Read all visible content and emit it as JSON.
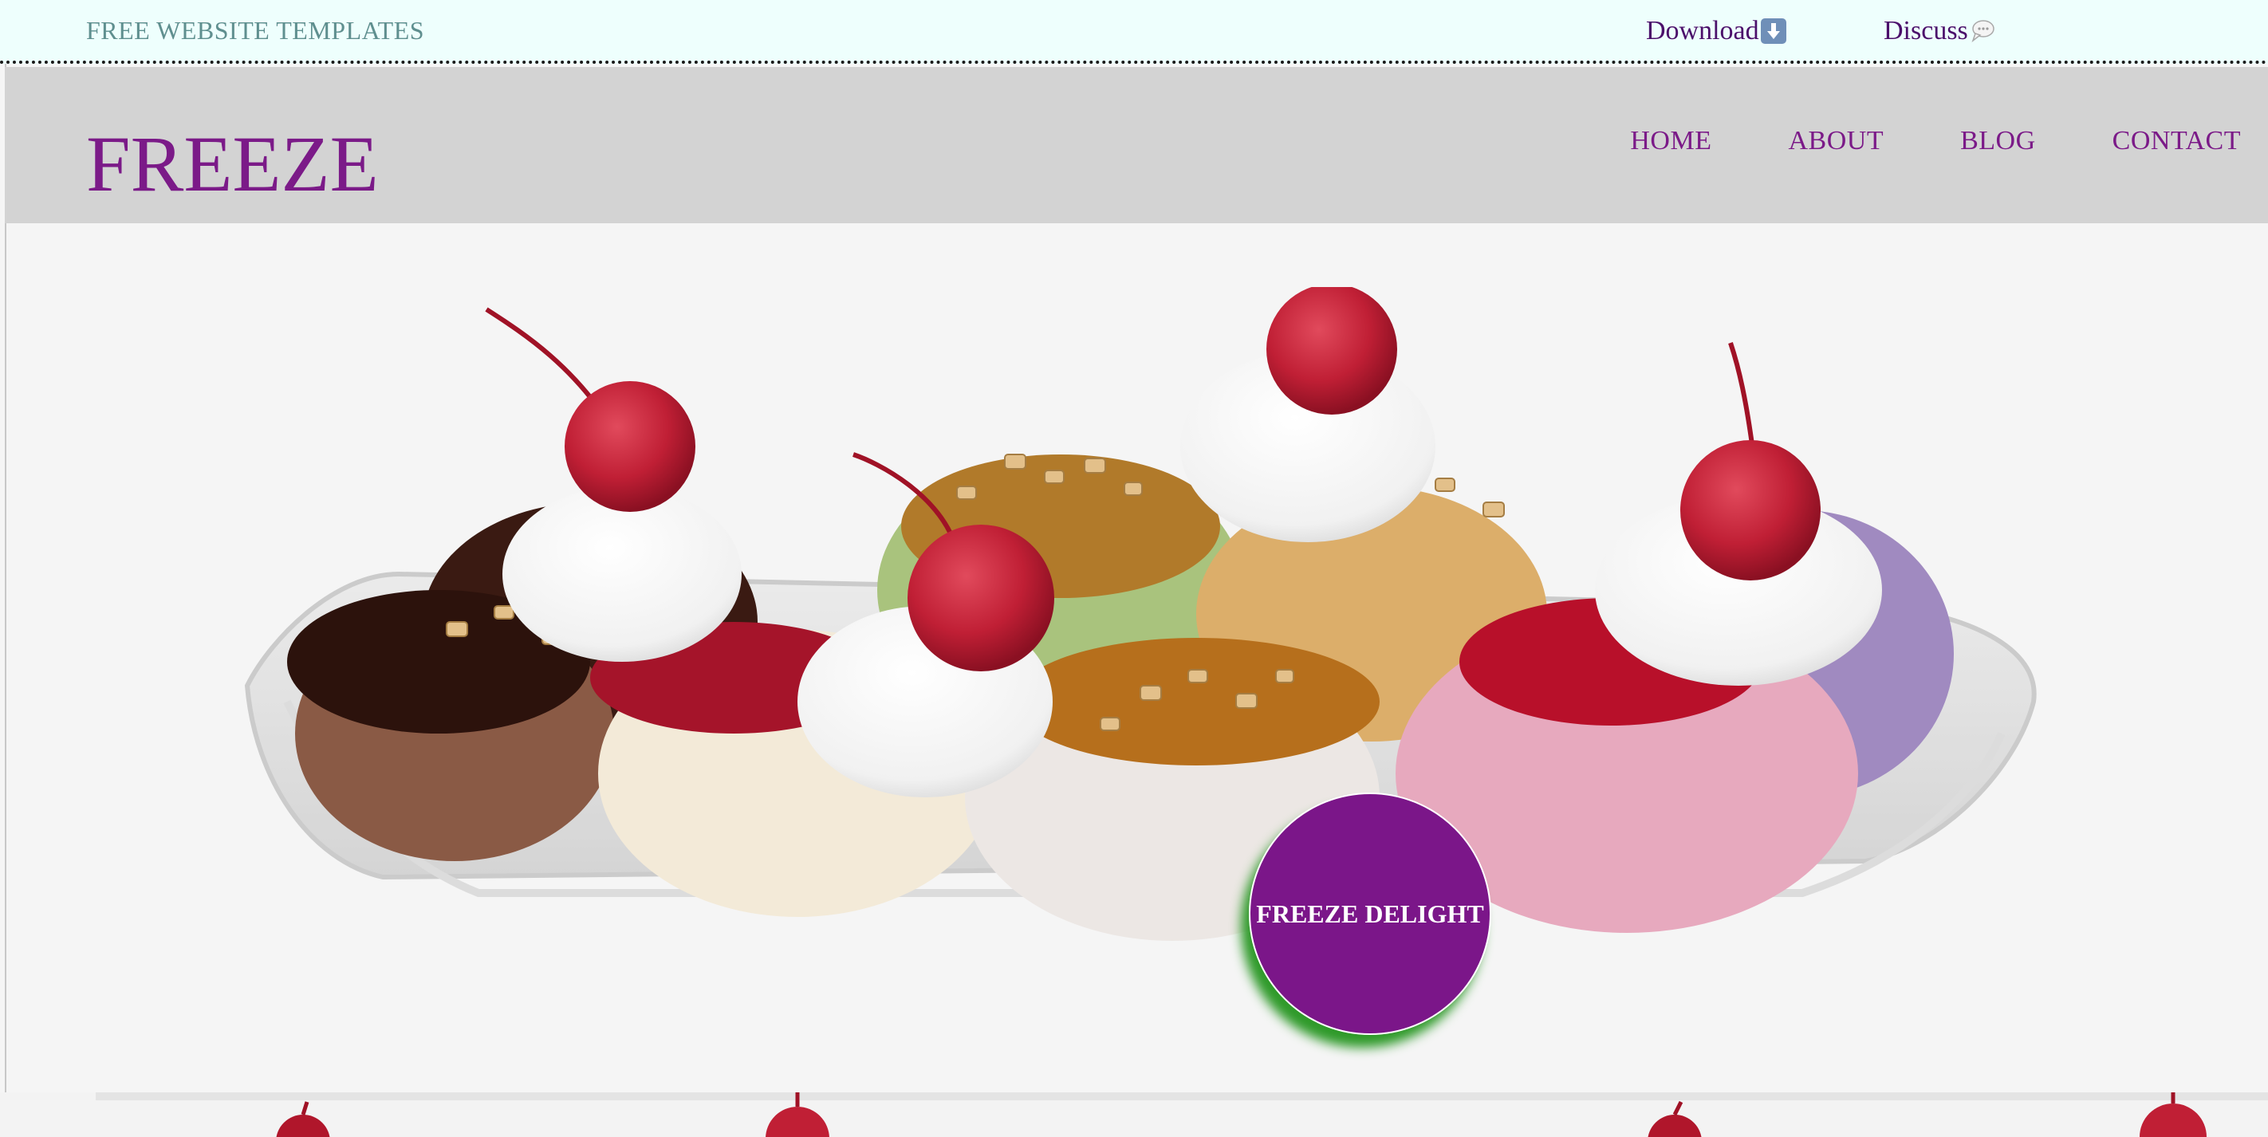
{
  "topbar": {
    "brand": "FREE WEBSITE TEMPLATES",
    "download_label": "Download",
    "discuss_label": "Discuss"
  },
  "header": {
    "logo": "FREEZE",
    "nav": [
      "HOME",
      "ABOUT",
      "BLOG",
      "CONTACT"
    ]
  },
  "hero": {
    "badge_label": "FREEZE DELIGHT"
  },
  "colors": {
    "topbar_bg": "#eefffd",
    "header_bg": "#d3d3d3",
    "accent_purple": "#7b1a88",
    "badge_shadow_green": "#2f9a2a",
    "brand_teal": "#5f8f8f"
  },
  "icons": [
    "download-icon",
    "chat-bubble-icon"
  ]
}
